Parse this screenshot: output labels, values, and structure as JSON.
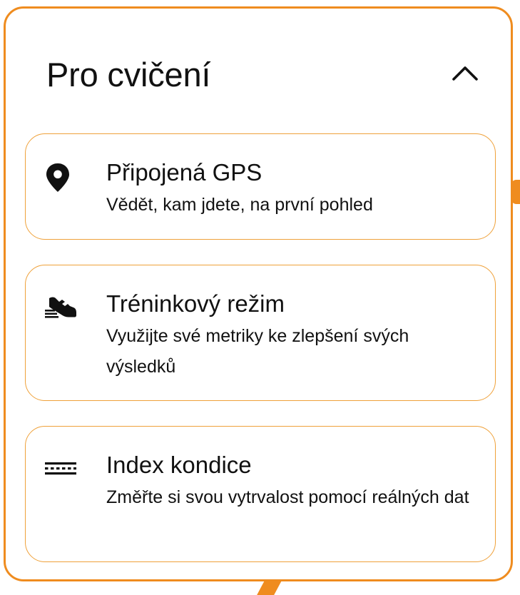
{
  "colors": {
    "accent": "#ef8c1f",
    "card_border": "#efa13a",
    "text": "#111111",
    "background": "#ffffff"
  },
  "panel": {
    "title": "Pro cvičení",
    "collapse_icon": "chevron-up-icon",
    "expanded": true
  },
  "features": [
    {
      "icon": "map-pin-icon",
      "title": "Připojená GPS",
      "description": "Vědět, kam jdete, na první pohled"
    },
    {
      "icon": "running-shoe-icon",
      "title": "Tréninkový režim",
      "description": "Využijte své metriky ke zlepšení svých výsledků"
    },
    {
      "icon": "dashed-lines-icon",
      "title": "Index kondice",
      "description": "Změřte si svou vytrvalost pomocí reálných dat"
    }
  ]
}
